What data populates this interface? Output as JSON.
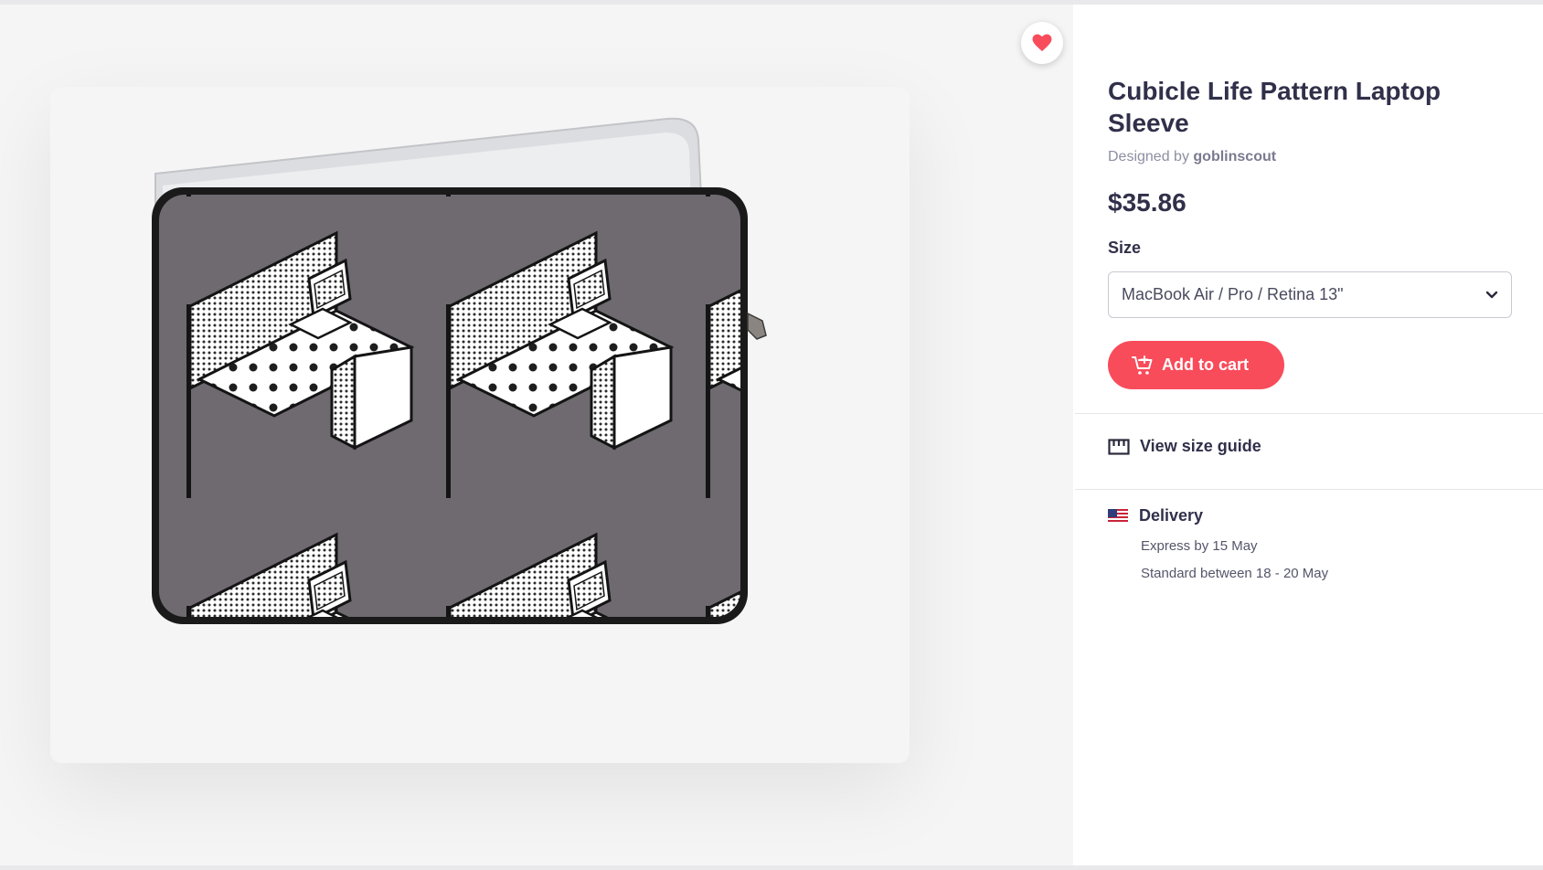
{
  "product": {
    "title": "Cubicle Life Pattern Laptop Sleeve",
    "designed_by_prefix": "Designed by",
    "designer_name": "goblinscout",
    "price": "$35.86"
  },
  "size": {
    "label": "Size",
    "selected": "MacBook Air / Pro / Retina 13\""
  },
  "actions": {
    "add_to_cart": "Add to cart",
    "view_size_guide": "View size guide"
  },
  "delivery": {
    "title": "Delivery",
    "express": "Express by 15 May",
    "standard": "Standard between 18 - 20 May"
  },
  "colors": {
    "accent": "#f84c5b",
    "title_text": "#31304a",
    "muted_text": "#8e8ea2",
    "sleeve_background": "#6e6a70"
  },
  "icons": {
    "favorite": "heart-icon",
    "cart": "cart-add-icon",
    "size_guide": "ruler-icon",
    "country": "us-flag-icon",
    "dropdown": "chevron-down-icon"
  }
}
